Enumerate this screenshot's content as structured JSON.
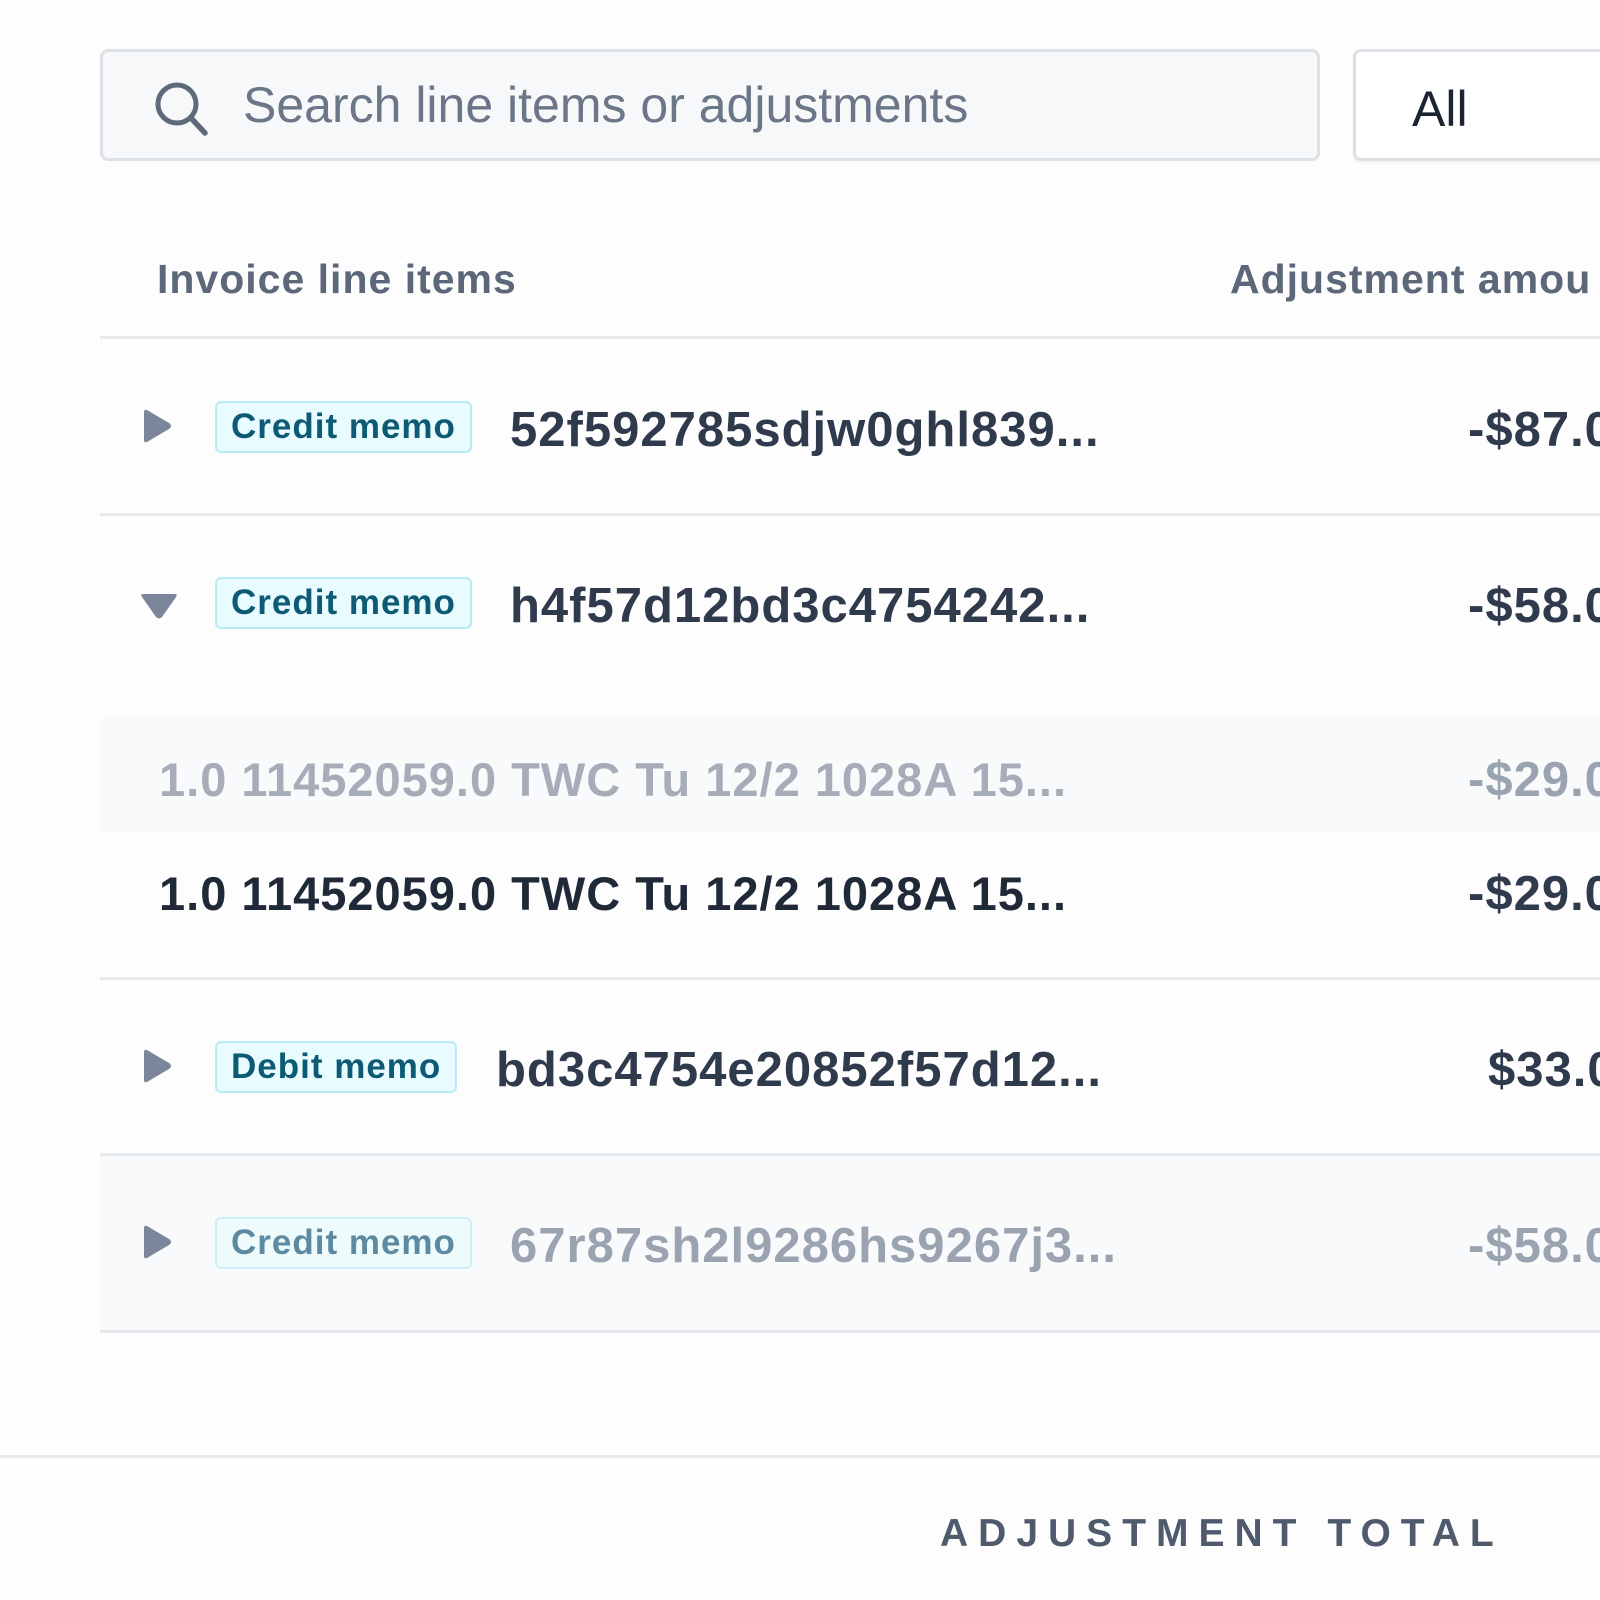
{
  "search": {
    "placeholder": "Search line items or adjustments",
    "icon": "search-icon"
  },
  "filter": {
    "selected": "All"
  },
  "table": {
    "headers": {
      "line_items": "Invoice line items",
      "amount": "Adjustment amou"
    },
    "rows": [
      {
        "type": "Credit memo",
        "id": "52f592785sdjw0ghl839...",
        "amount": "-$87.0",
        "expanded": false,
        "faded": false
      },
      {
        "type": "Credit memo",
        "id": "h4f57d12bd3c4754242...",
        "amount": "-$58.0",
        "expanded": true,
        "faded": false,
        "children": [
          {
            "text": "1.0 11452059.0 TWC Tu 12/2 1028A 15...",
            "amount": "-$29.0",
            "faded": true
          },
          {
            "text": "1.0 11452059.0 TWC Tu 12/2 1028A 15...",
            "amount": "-$29.0",
            "faded": false
          }
        ]
      },
      {
        "type": "Debit memo",
        "id": "bd3c4754e20852f57d12...",
        "amount": "$33.0",
        "expanded": false,
        "faded": false
      },
      {
        "type": "Credit memo",
        "id": "67r87sh2l9286hs9267j3...",
        "amount": "-$58.0",
        "expanded": false,
        "faded": true
      }
    ]
  },
  "footer": {
    "total_label": "ADJUSTMENT TOTAL"
  },
  "colors": {
    "badge_text": "#0c5a73",
    "badge_bg": "#e8fbfe",
    "badge_border": "#b5ecf5",
    "primary_text": "#2f3a4d",
    "muted_text": "#9aa3b0"
  }
}
